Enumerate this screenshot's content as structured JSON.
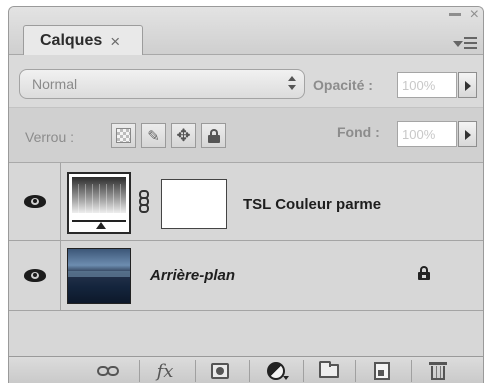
{
  "panel": {
    "tab_label": "Calques",
    "tab_close": "×",
    "panel_close": "×"
  },
  "blend": {
    "mode": "Normal",
    "opacity_label": "Opacité :",
    "opacity_value": "100%"
  },
  "locks": {
    "label": "Verrou :",
    "fill_label": "Fond :",
    "fill_value": "100%"
  },
  "layers": [
    {
      "name": "TSL Couleur parme",
      "type": "adjustment",
      "visible": true
    },
    {
      "name": "Arrière-plan",
      "type": "background",
      "visible": true,
      "locked": true
    }
  ],
  "toolbar": {
    "fx_label": "fx"
  }
}
